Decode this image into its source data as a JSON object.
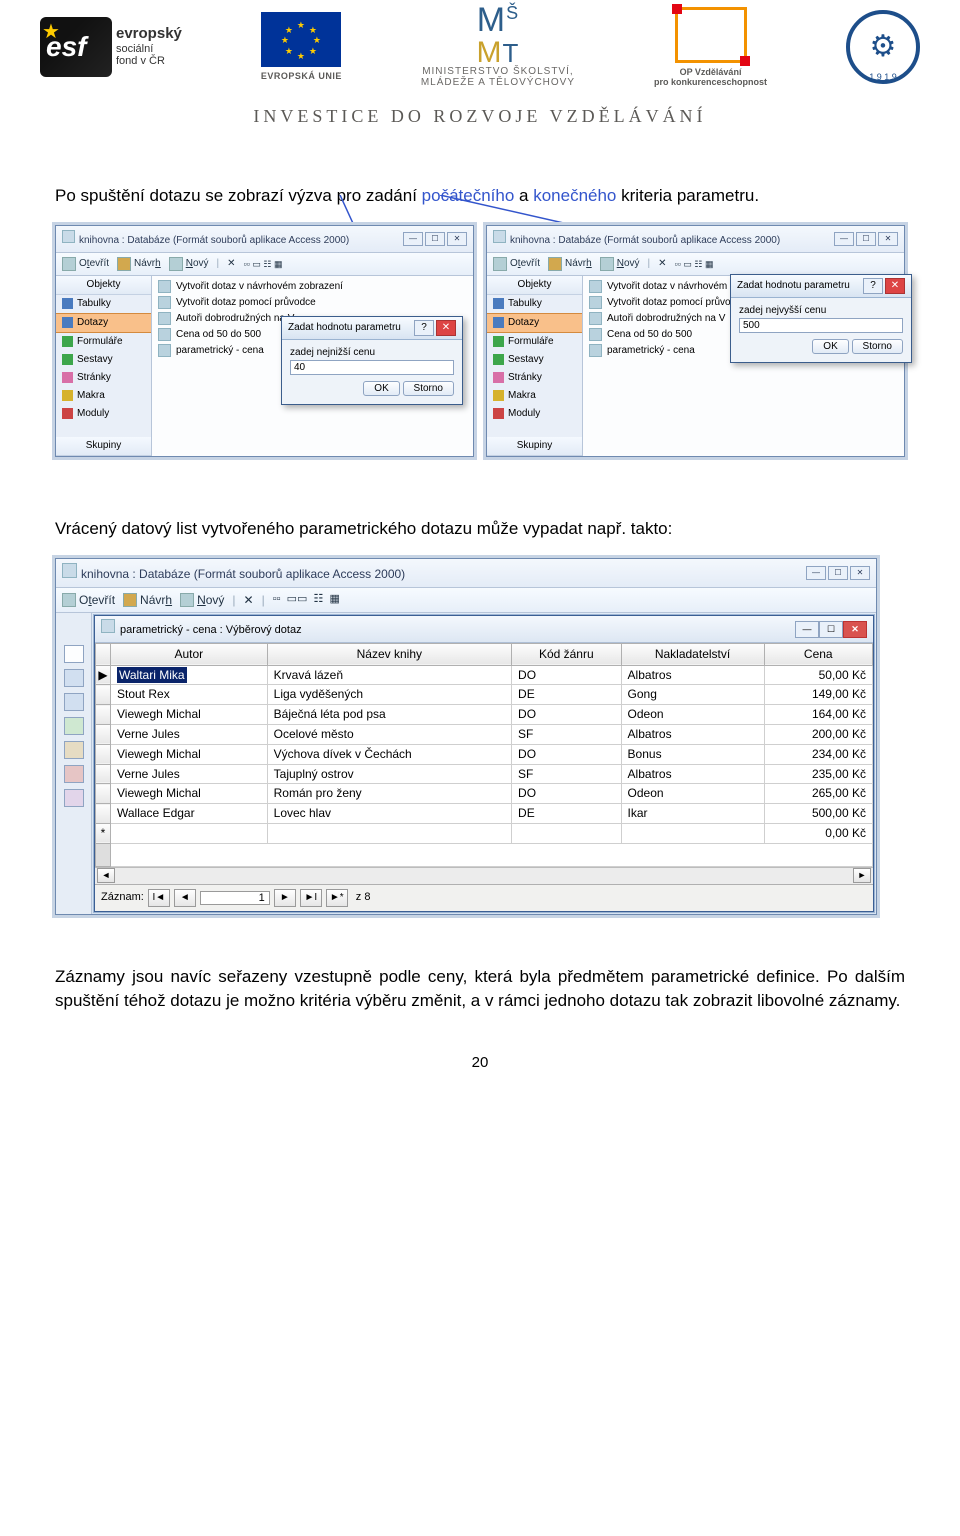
{
  "header": {
    "esf_text1": "evropský",
    "esf_text2": "sociální",
    "esf_text3": "fond v ČR",
    "eu_label": "EVROPSKÁ UNIE",
    "msmt_line1": "MINISTERSTVO ŠKOLSTVÍ,",
    "msmt_line2": "MLÁDEŽE A TĚLOVÝCHOVY",
    "opv_line1": "OP Vzdělávání",
    "opv_line2": "pro konkurenceschopnost",
    "gear_year": "1 9 1 9",
    "tagline": "INVESTICE DO ROZVOJE VZDĚLÁVÁNÍ"
  },
  "para1_a": "Po spuštění dotazu se zobrazí výzva pro zadání ",
  "para1_b": "počátečního",
  "para1_c": " a ",
  "para1_d": "konečného",
  "para1_e": " kriteria parametru.",
  "access": {
    "title": "knihovna : Databáze (Formát souborů aplikace Access 2000)",
    "tb_open": "Otevřít",
    "tb_design": "Návrh",
    "tb_new": "Nový",
    "sidebar_header": "Objekty",
    "sidebar_items": [
      "Tabulky",
      "Dotazy",
      "Formuláře",
      "Sestavy",
      "Stránky",
      "Makra",
      "Moduly"
    ],
    "sidebar_footer": "Skupiny",
    "main_items": [
      "Vytvořit dotaz v návrhovém zobrazení",
      "Vytvořit dotaz pomocí průvodce",
      "Autoři dobrodružných na V",
      "Cena od 50 do 500",
      "parametrický - cena"
    ]
  },
  "dialog1": {
    "title": "Zadat hodnotu parametru",
    "label": "zadej nejnižší cenu",
    "value": "40",
    "ok": "OK",
    "cancel": "Storno"
  },
  "dialog2": {
    "title": "Zadat hodnotu parametru",
    "label": "zadej nejvyšší cenu",
    "value": "500",
    "ok": "OK",
    "cancel": "Storno"
  },
  "para2": "Vrácený datový list vytvořeného parametrického dotazu může vypadat např. takto:",
  "subwin_title": "parametrický - cena : Výběrový dotaz",
  "columns": [
    "Autor",
    "Název knihy",
    "Kód žánru",
    "Nakladatelství",
    "Cena"
  ],
  "rows": [
    {
      "autor": "Waltari Mika",
      "nazev": "Krvavá lázeň",
      "kod": "DO",
      "nakl": "Albatros",
      "cena": "50,00 Kč"
    },
    {
      "autor": "Stout Rex",
      "nazev": "Liga vyděšených",
      "kod": "DE",
      "nakl": "Gong",
      "cena": "149,00 Kč"
    },
    {
      "autor": "Viewegh Michal",
      "nazev": "Báječná léta pod psa",
      "kod": "DO",
      "nakl": "Odeon",
      "cena": "164,00 Kč"
    },
    {
      "autor": "Verne Jules",
      "nazev": "Ocelové město",
      "kod": "SF",
      "nakl": "Albatros",
      "cena": "200,00 Kč"
    },
    {
      "autor": "Viewegh Michal",
      "nazev": "Výchova dívek v Čechách",
      "kod": "DO",
      "nakl": "Bonus",
      "cena": "234,00 Kč"
    },
    {
      "autor": "Verne Jules",
      "nazev": "Tajuplný ostrov",
      "kod": "SF",
      "nakl": "Albatros",
      "cena": "235,00 Kč"
    },
    {
      "autor": "Viewegh Michal",
      "nazev": "Román pro ženy",
      "kod": "DO",
      "nakl": "Odeon",
      "cena": "265,00 Kč"
    },
    {
      "autor": "Wallace Edgar",
      "nazev": "Lovec hlav",
      "kod": "DE",
      "nakl": "Ikar",
      "cena": "500,00 Kč"
    }
  ],
  "emptyrow_cena": "0,00 Kč",
  "recordnav": {
    "label": "Záznam:",
    "value": "1",
    "of": "z 8"
  },
  "para3": "Záznamy jsou navíc seřazeny vzestupně podle ceny, která byla předmětem parametrické definice. Po dalším spuštění téhož dotazu je možno kritéria výběru změnit, a v rámci jednoho dotazu tak zobrazit libovolné záznamy.",
  "pagenum": "20"
}
